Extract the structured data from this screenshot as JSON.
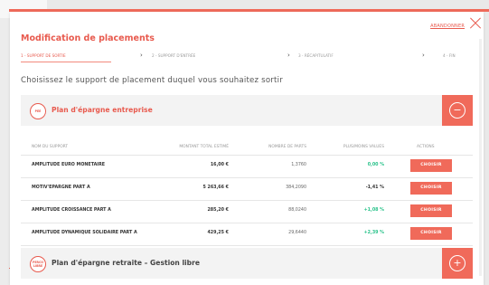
{
  "header": {
    "title": "Modification de placements",
    "close_label": "ABANDONNER"
  },
  "steps": [
    {
      "label": "1 - SUPPORT DE SORTIE",
      "active": true
    },
    {
      "label": "2 - SUPPORT D'ENTRÉE",
      "active": false
    },
    {
      "label": "3 - RÉCAPITULATIF",
      "active": false
    },
    {
      "label": "4 - FIN",
      "active": false
    }
  ],
  "step_arrow": "›",
  "subtitle": "Choisissez le support de placement duquel vous souhaitez sortir",
  "section1": {
    "badge": "PEE",
    "title": "Plan d'épargne entreprise",
    "toggle": "−"
  },
  "table": {
    "headers": {
      "name": "NOM DU SUPPORT",
      "amount": "MONTANT TOTAL ESTIMÉ",
      "parts": "NOMBRE DE PARTS",
      "pv": "PLUS/MOINS VALUES",
      "actions": "ACTIONS"
    },
    "rows": [
      {
        "name": "AMPLITUDE EURO MONETAIRE",
        "amount": "16,00 €",
        "parts": "1,3760",
        "pv": "0,00 %",
        "action": "CHOISIR"
      },
      {
        "name": "MOTIV'EPARGNE PART A",
        "amount": "5 263,66 €",
        "parts": "384,2090",
        "pv": "-1,41 %",
        "action": "CHOISIR"
      },
      {
        "name": "AMPLITUDE CROISSANCE PART A",
        "amount": "285,20 €",
        "parts": "88,0240",
        "pv": "+1,08 %",
        "action": "CHOISIR"
      },
      {
        "name": "AMPLITUDE DYNAMIQUE SOLIDAIRE PART A",
        "amount": "429,25 €",
        "parts": "29,6440",
        "pv": "+2,39 %",
        "action": "CHOISIR"
      }
    ]
  },
  "section2": {
    "badge_line1": "PERCO",
    "badge_line2": "LIBRE",
    "title": "Plan d'épargne retraite – Gestion libre",
    "toggle": "+"
  },
  "colors": {
    "accent": "#f06a5a",
    "positive": "#29c28a"
  }
}
